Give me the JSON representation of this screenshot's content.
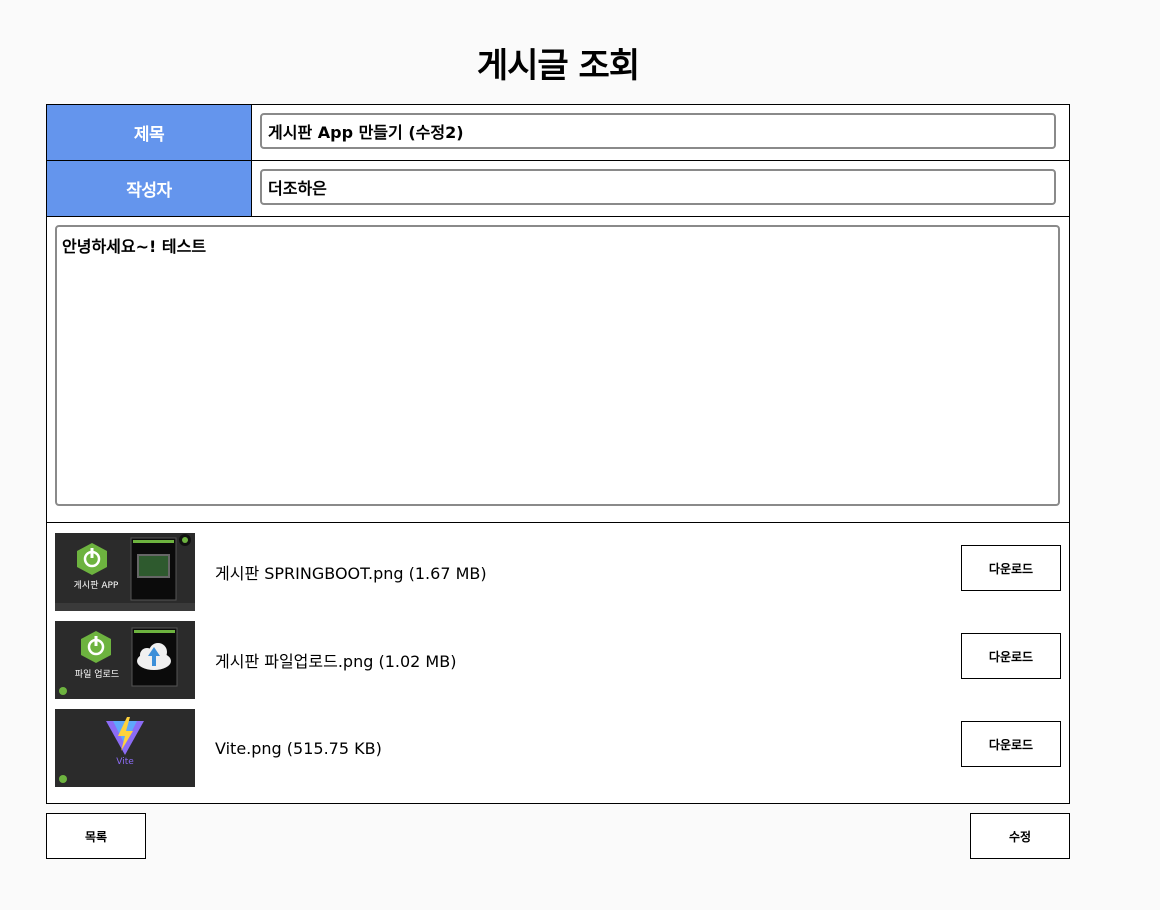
{
  "page": {
    "title": "게시글 조회"
  },
  "form": {
    "title_label": "제목",
    "title_value": "게시판 App 만들기 (수정2)",
    "author_label": "작성자",
    "author_value": "더조하은",
    "content_value": "안녕하세요~! 테스트"
  },
  "files": [
    {
      "name": "게시판 SPRINGBOOT.png (1.67 MB)",
      "thumb_caption": "게시판 APP",
      "download_label": "다운로드"
    },
    {
      "name": "게시판 파일업로드.png (1.02 MB)",
      "thumb_caption": "파일 업로드",
      "download_label": "다운로드"
    },
    {
      "name": "Vite.png (515.75 KB)",
      "thumb_caption": "Vite",
      "download_label": "다운로드"
    }
  ],
  "actions": {
    "list_label": "목록",
    "edit_label": "수정"
  },
  "colors": {
    "label_bg": "#6495ed",
    "spring_green": "#6db33f",
    "vite_purple": "#8c6cf5",
    "vite_yellow": "#ffd23c"
  }
}
